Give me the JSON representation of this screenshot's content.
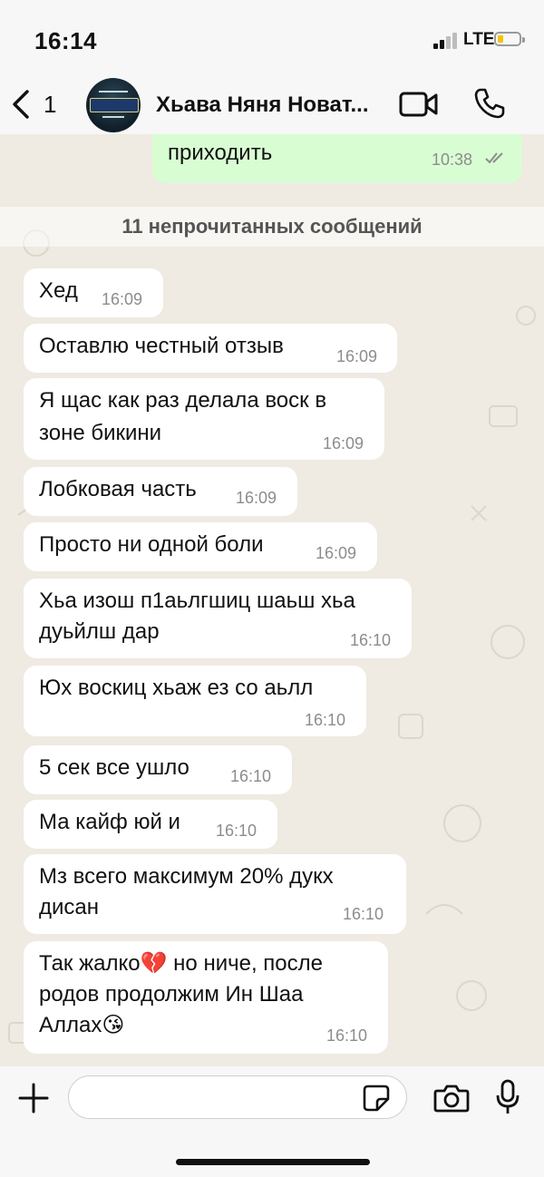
{
  "status": {
    "time": "16:14",
    "network": "LTE"
  },
  "header": {
    "back_count": "1",
    "contact_name": "Хьава Няня Новат..."
  },
  "chat": {
    "sent": {
      "text": "приходить",
      "time": "10:38"
    },
    "unread_banner": "11 непрочитанных сообщений",
    "messages": [
      {
        "lines": [
          "Хед"
        ],
        "time": "16:09"
      },
      {
        "lines": [
          "Оставлю честный отзыв"
        ],
        "time": "16:09"
      },
      {
        "lines": [
          "Я щас как раз делала воск в",
          "зоне бикини"
        ],
        "time": "16:09"
      },
      {
        "lines": [
          "Лобковая часть"
        ],
        "time": "16:09"
      },
      {
        "lines": [
          "Просто ни одной боли"
        ],
        "time": "16:09"
      },
      {
        "lines": [
          "Хьа изош п1аьлгшиц шаьш хьа",
          "дуьйлш дар"
        ],
        "time": "16:10"
      },
      {
        "lines": [
          "Юх воскиц хьаж ез со аьлл"
        ],
        "time": "16:10"
      },
      {
        "lines": [
          "5 сек все ушло"
        ],
        "time": "16:10"
      },
      {
        "lines": [
          "Ма кайф юй и"
        ],
        "time": "16:10"
      },
      {
        "lines": [
          "Мз всего максимум 20% дукх",
          "дисан"
        ],
        "time": "16:10"
      },
      {
        "lines": [
          "Так жалко💔 но ниче, после",
          "родов продолжим Ин Шаа",
          "Аллах😘"
        ],
        "time": "16:10"
      }
    ]
  },
  "icons": {
    "back": "chevron-left-icon",
    "video": "video-call-icon",
    "phone": "phone-icon",
    "plus": "plus-icon",
    "sticker": "sticker-icon",
    "camera": "camera-icon",
    "mic": "microphone-icon"
  },
  "colors": {
    "incoming": "#ffffff",
    "outgoing": "#d9fdd3",
    "background": "#efeae2",
    "read_checks": "#8c8c8c"
  }
}
